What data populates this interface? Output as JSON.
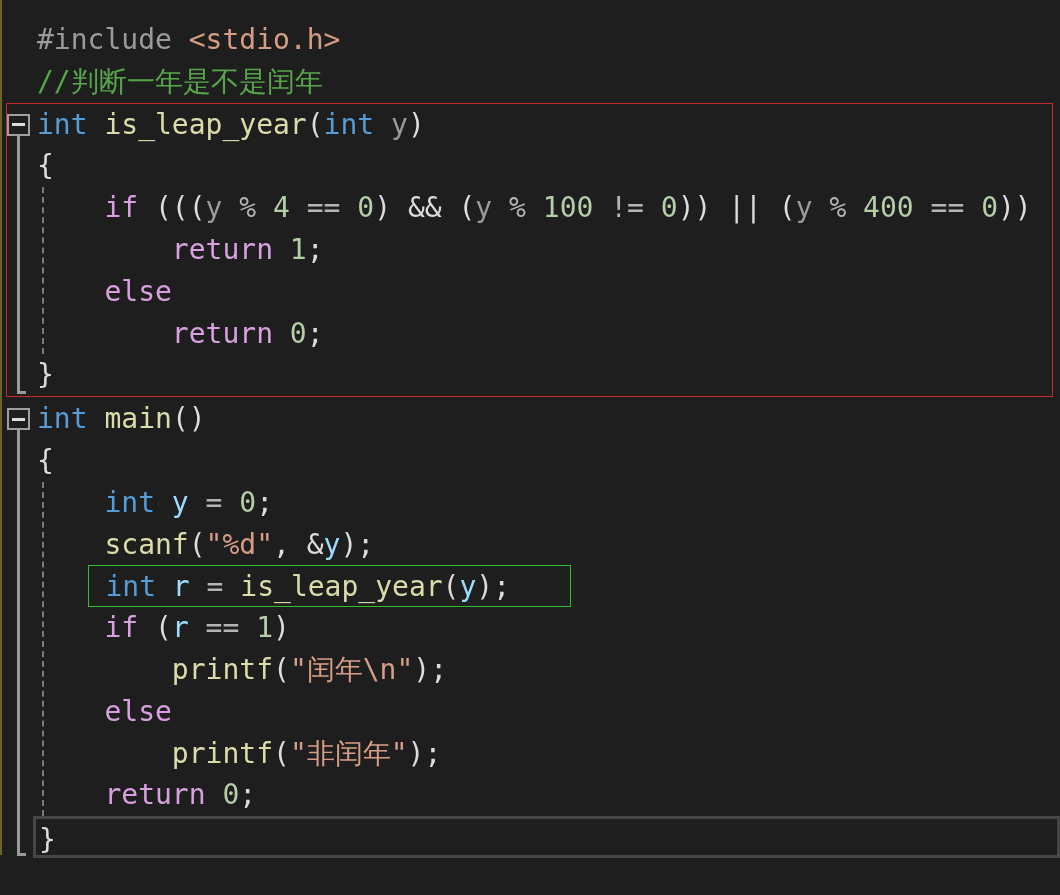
{
  "lines": [
    {
      "tokens": [
        {
          "text": "#include",
          "kind": "pre"
        },
        {
          "text": " <stdio.h>",
          "kind": "str"
        }
      ]
    },
    {
      "tokens": [
        {
          "text": "//判断一年是不是闰年",
          "kind": "cmt"
        }
      ]
    }
  ],
  "functions": [
    {
      "expanded": true,
      "boxed": true,
      "header": {
        "tokens": [
          {
            "text": "int",
            "kind": "kw"
          },
          {
            "text": " is_leap_year",
            "kind": "fn"
          },
          {
            "text": "(",
            "kind": "plain"
          },
          {
            "text": "int",
            "kind": "kw"
          },
          {
            "text": " y",
            "kind": "param"
          },
          {
            "text": ")",
            "kind": "plain"
          }
        ]
      },
      "open": {
        "tokens": [
          {
            "text": "{",
            "kind": "plain"
          }
        ]
      },
      "body": [
        {
          "tokens": [
            {
              "text": "    if",
              "kind": "ctrl"
            },
            {
              "text": " (((",
              "kind": "plain"
            },
            {
              "text": "y",
              "kind": "param"
            },
            {
              "text": " % ",
              "kind": "op"
            },
            {
              "text": "4",
              "kind": "num"
            },
            {
              "text": " == ",
              "kind": "op"
            },
            {
              "text": "0",
              "kind": "num"
            },
            {
              "text": ") && (",
              "kind": "plain"
            },
            {
              "text": "y",
              "kind": "param"
            },
            {
              "text": " % ",
              "kind": "op"
            },
            {
              "text": "100",
              "kind": "num"
            },
            {
              "text": " != ",
              "kind": "op"
            },
            {
              "text": "0",
              "kind": "num"
            },
            {
              "text": ")) || (",
              "kind": "plain"
            },
            {
              "text": "y",
              "kind": "param"
            },
            {
              "text": " % ",
              "kind": "op"
            },
            {
              "text": "400",
              "kind": "num"
            },
            {
              "text": " == ",
              "kind": "op"
            },
            {
              "text": "0",
              "kind": "num"
            },
            {
              "text": "))",
              "kind": "plain"
            }
          ]
        },
        {
          "tokens": [
            {
              "text": "        return",
              "kind": "ctrl"
            },
            {
              "text": " 1",
              "kind": "num"
            },
            {
              "text": ";",
              "kind": "plain"
            }
          ]
        },
        {
          "tokens": [
            {
              "text": "    else",
              "kind": "ctrl"
            }
          ]
        },
        {
          "tokens": [
            {
              "text": "        return",
              "kind": "ctrl"
            },
            {
              "text": " 0",
              "kind": "num"
            },
            {
              "text": ";",
              "kind": "plain"
            }
          ]
        }
      ],
      "close": {
        "tokens": [
          {
            "text": "}",
            "kind": "plain"
          }
        ]
      }
    },
    {
      "expanded": true,
      "header": {
        "tokens": [
          {
            "text": "int",
            "kind": "kw"
          },
          {
            "text": " main",
            "kind": "fn"
          },
          {
            "text": "()",
            "kind": "plain"
          }
        ]
      },
      "open": {
        "tokens": [
          {
            "text": "{",
            "kind": "plain"
          }
        ]
      },
      "body": [
        {
          "tokens": [
            {
              "text": "    int",
              "kind": "kw"
            },
            {
              "text": " y",
              "kind": "local"
            },
            {
              "text": " = ",
              "kind": "op"
            },
            {
              "text": "0",
              "kind": "num"
            },
            {
              "text": ";",
              "kind": "plain"
            }
          ]
        },
        {
          "tokens": [
            {
              "text": "    scanf",
              "kind": "fn"
            },
            {
              "text": "(",
              "kind": "plain"
            },
            {
              "text": "\"%d\"",
              "kind": "str"
            },
            {
              "text": ", &",
              "kind": "plain"
            },
            {
              "text": "y",
              "kind": "local"
            },
            {
              "text": ");",
              "kind": "plain"
            }
          ]
        },
        {
          "boxed": true,
          "tokens": [
            {
              "text": "    int",
              "kind": "kw"
            },
            {
              "text": " r",
              "kind": "local"
            },
            {
              "text": " = ",
              "kind": "op"
            },
            {
              "text": "is_leap_year",
              "kind": "fn"
            },
            {
              "text": "(",
              "kind": "plain"
            },
            {
              "text": "y",
              "kind": "local"
            },
            {
              "text": ");",
              "kind": "plain"
            }
          ]
        },
        {
          "tokens": [
            {
              "text": "    if",
              "kind": "ctrl"
            },
            {
              "text": " (",
              "kind": "plain"
            },
            {
              "text": "r",
              "kind": "local"
            },
            {
              "text": " == ",
              "kind": "op"
            },
            {
              "text": "1",
              "kind": "num"
            },
            {
              "text": ")",
              "kind": "plain"
            }
          ]
        },
        {
          "tokens": [
            {
              "text": "        printf",
              "kind": "fn"
            },
            {
              "text": "(",
              "kind": "plain"
            },
            {
              "text": "\"闰年\\n\"",
              "kind": "str"
            },
            {
              "text": ");",
              "kind": "plain"
            }
          ]
        },
        {
          "tokens": [
            {
              "text": "    else",
              "kind": "ctrl"
            }
          ]
        },
        {
          "tokens": [
            {
              "text": "        printf",
              "kind": "fn"
            },
            {
              "text": "(",
              "kind": "plain"
            },
            {
              "text": "\"非闰年\"",
              "kind": "str"
            },
            {
              "text": ");",
              "kind": "plain"
            }
          ]
        },
        {
          "tokens": [
            {
              "text": "    return",
              "kind": "ctrl"
            },
            {
              "text": " 0",
              "kind": "num"
            },
            {
              "text": ";",
              "kind": "plain"
            }
          ]
        }
      ],
      "close": {
        "current": true,
        "tokens": [
          {
            "text": "}",
            "kind": "plain"
          }
        ]
      }
    }
  ]
}
